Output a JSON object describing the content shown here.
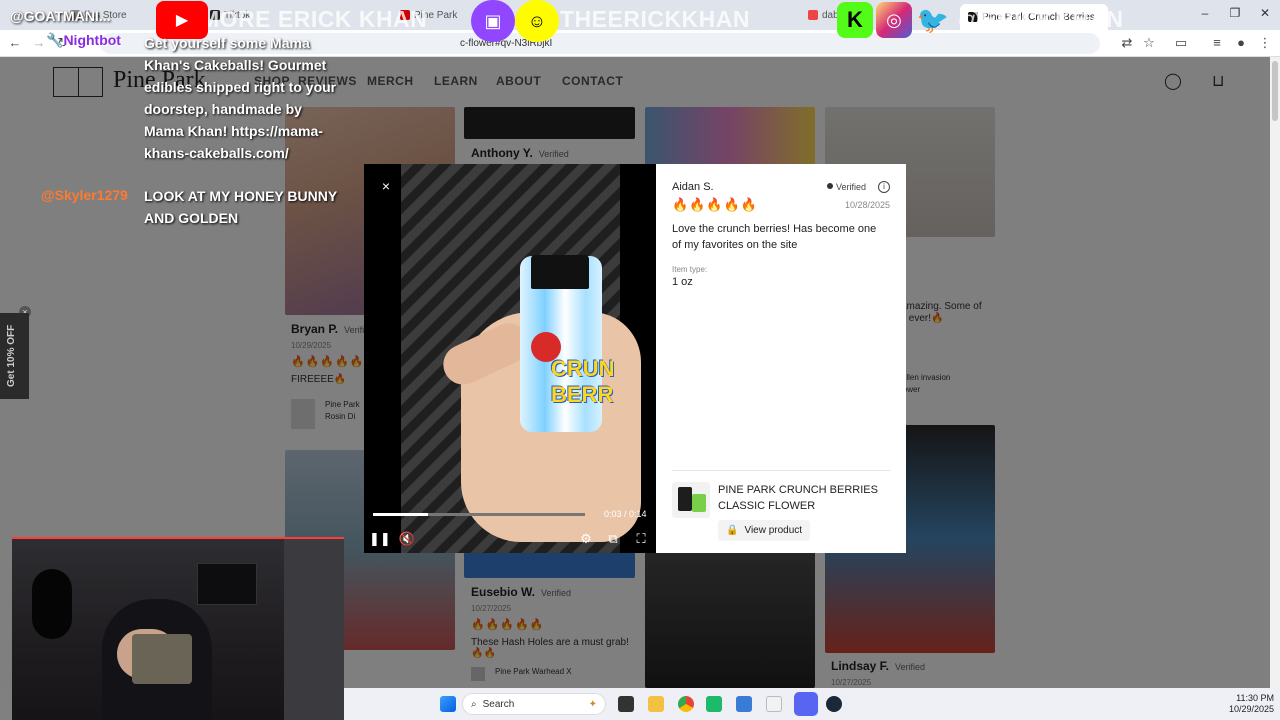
{
  "browser": {
    "tabs": [
      "ffas Store",
      "Tiktok",
      "Pine Park",
      "dab",
      "Pine Park Crunch Berries"
    ],
    "url_suffix": "c-flower#qv-N3iRbjkI",
    "nightbot": "Nightbot"
  },
  "site": {
    "logo": "Pine Park",
    "nav": [
      "SHOP",
      "REVIEWS",
      "MERCH",
      "LEARN",
      "ABOUT",
      "CONTACT"
    ],
    "side_tab": "Get 10% OFF",
    "reviews": [
      {
        "name": "Anthony Y.",
        "verified": "Verified"
      },
      {
        "name": "Bryan P.",
        "verified": "Verified",
        "date": "10/29/2025",
        "stars": "🔥🔥🔥🔥🔥",
        "text": "FIREEEE🔥",
        "product": "Pine Park",
        "product2": "Rosin Di"
      },
      {
        "name": "Eusebio W.",
        "verified": "Verified",
        "date": "10/27/2025",
        "stars": "🔥🔥🔥🔥🔥",
        "text": "These Hash Holes are a must grab! 🔥🔥",
        "product": "Pine Park Warhead X"
      },
      {
        "name": "Lindsay F.",
        "verified": "Verified",
        "date": "10/27/2025"
      },
      {
        "text": "amazing. Some of",
        "text2": "it ever!🔥",
        "product": "Allen invasion",
        "product2": "lower"
      }
    ]
  },
  "modal": {
    "close": "×",
    "video": {
      "current": "0:03",
      "duration": "0:14",
      "progress": 0.26
    },
    "review": {
      "name": "Aidan S.",
      "verified": "Verified",
      "stars": "🔥🔥🔥🔥🔥",
      "date": "10/28/2025",
      "body": "Love the crunch berries! Has become one of my favorites on the site",
      "item_type_label": "Item type:",
      "item_type": "1 oz"
    },
    "product": {
      "name": "PINE PARK CRUNCH BERRIES CLASSIC FLOWER",
      "button": "View product"
    },
    "jar_label": "CRUN BERR"
  },
  "overlay": {
    "top_left": "@GOATMANI...",
    "top_mid": "MORE ERICK KHAN",
    "top_right": "THEERICKKHAN",
    "top_far": "@ERICKKHAN",
    "chat1_user": "Nightbot",
    "chat1_msg": "Get yourself some Mama Khan's Cakeballs! Gourmet edibles shipped right to your doorstep, handmade by Mama Khan! https://mama-khans-cakeballs.com/",
    "chat2_user": "@Skyler1279",
    "chat2_msg": "LOOK AT MY HONEY BUNNY AND GOLDEN"
  },
  "taskbar": {
    "search": "Search",
    "time": "11:30 PM",
    "date": "10/29/2025"
  },
  "colors": {
    "youtube": "#ff0000",
    "twitch": "#9146ff",
    "snapchat": "#fffc00",
    "kick": "#53fc18",
    "twitter": "#1da1f2",
    "chat_orange": "#ff7a2f",
    "chat_purple": "#8a2be2"
  }
}
